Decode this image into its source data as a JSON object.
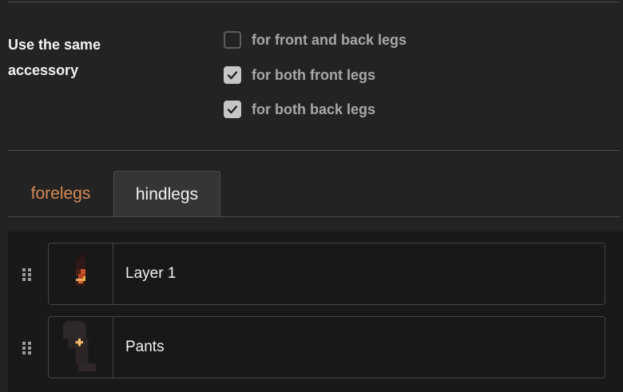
{
  "accessory": {
    "label": "Use the same accessory",
    "options": [
      {
        "label": "for front and back legs",
        "checked": false
      },
      {
        "label": "for both front legs",
        "checked": true
      },
      {
        "label": "for both back legs",
        "checked": true
      }
    ]
  },
  "tabs": [
    {
      "label": "forelegs",
      "active": false
    },
    {
      "label": "hindlegs",
      "active": true
    }
  ],
  "layers": [
    {
      "name": "Layer 1",
      "icon": "drag-handle-icon"
    },
    {
      "name": "Pants",
      "icon": "drag-handle-icon"
    }
  ],
  "colors": {
    "background": "#232323",
    "tab_inactive_text": "#d98a54",
    "checkbox_checked": "#c6c6c6",
    "layer_panel": "#191919"
  }
}
